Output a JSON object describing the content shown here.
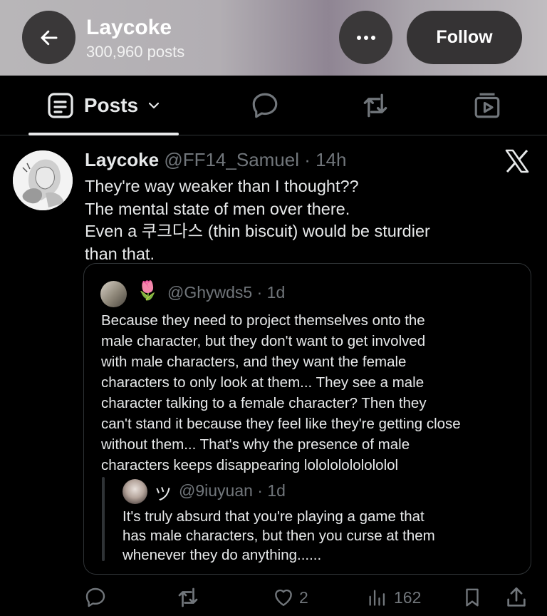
{
  "header": {
    "profile_name": "Laycoke",
    "post_count": "300,960 posts",
    "follow_label": "Follow",
    "more_icon": "ellipsis-icon",
    "back_icon": "arrow-left-icon"
  },
  "tabs": {
    "posts_label": "Posts",
    "items": [
      "posts",
      "replies",
      "reposts",
      "media"
    ]
  },
  "post": {
    "author_name": "Laycoke",
    "meta": "@FF14_Samuel · 14h",
    "lines": [
      "They're way weaker than I thought??",
      "The mental state of men over there.",
      "Even a 쿠크다스 (thin biscuit) would be sturdier",
      "than that."
    ],
    "quote": {
      "emoji": "🌷",
      "meta": "@Ghywds5 · 1d",
      "lines": [
        "Because they need to project themselves onto the",
        "male character, but they don't want to get involved",
        "with male characters, and they want the female",
        "characters to only look at them... They see a male",
        "character talking to a female character? Then they",
        "can't stand it because they feel like they're getting close",
        "without them... That's why the presence of male",
        "characters keeps disappearing lolololololololol"
      ],
      "nested": {
        "name": "ツ",
        "meta": "@9iuyuan · 1d",
        "lines": [
          "It's truly absurd that you're playing a game that",
          "has male characters, but then you curse at them",
          "whenever they do anything......"
        ]
      }
    },
    "actions": {
      "likes": "2",
      "views": "162"
    }
  },
  "colors": {
    "background": "#000000",
    "text_primary": "#e7e9ea",
    "text_secondary": "#71767b",
    "border": "#2f3336",
    "button_dark": "#353334"
  }
}
